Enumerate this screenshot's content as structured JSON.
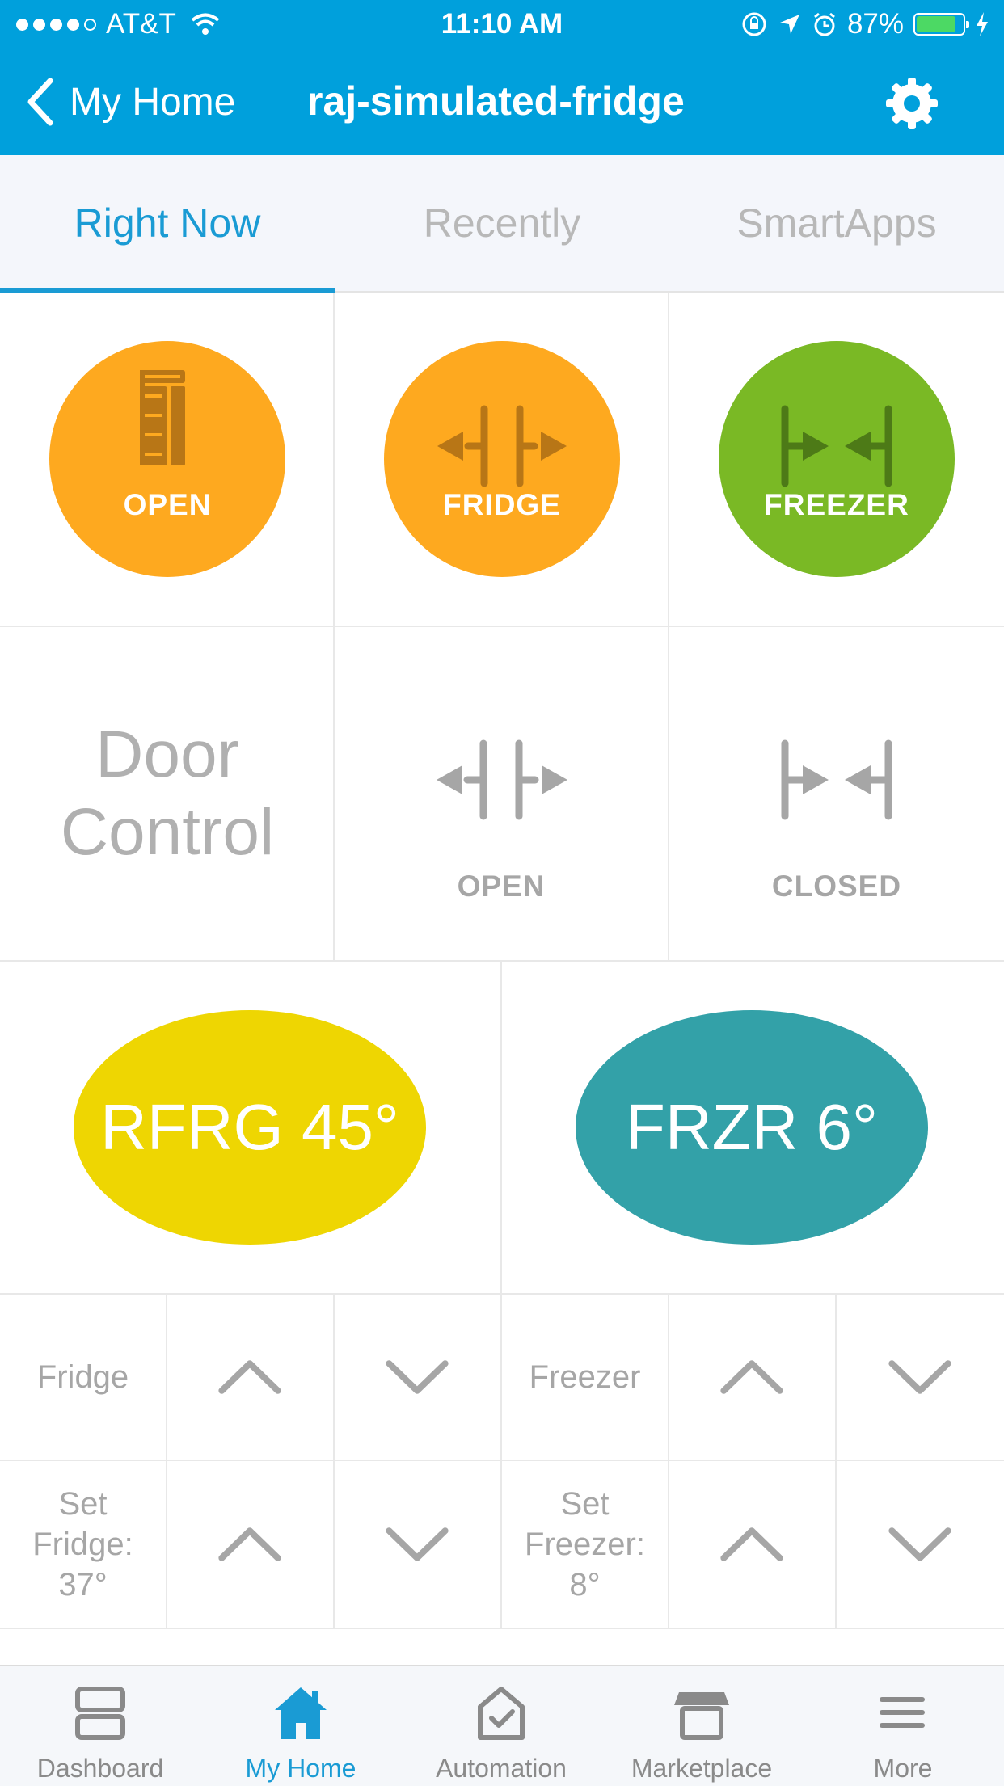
{
  "status_bar": {
    "carrier": "AT&T",
    "time": "11:10 AM",
    "battery": "87%",
    "battery_level": 0.87
  },
  "nav": {
    "back_label": "My Home",
    "title": "raj-simulated-fridge"
  },
  "tabs": [
    {
      "label": "Right Now",
      "active": true
    },
    {
      "label": "Recently",
      "active": false
    },
    {
      "label": "SmartApps",
      "active": false
    }
  ],
  "tiles": {
    "door_state": "OPEN",
    "fridge_state": "FRIDGE",
    "freezer_state": "FREEZER",
    "door_control_line1": "Door",
    "door_control_line2": "Control",
    "open_label": "OPEN",
    "closed_label": "CLOSED",
    "fridge_temp": "RFRG 45°",
    "freezer_temp": "FRZR 6°",
    "fridge_label": "Fridge",
    "freezer_label": "Freezer",
    "set_fridge": [
      "Set",
      "Fridge:",
      "37°"
    ],
    "set_freezer": [
      "Set",
      "Freezer:",
      "8°"
    ]
  },
  "colors": {
    "header": "#00a0dc",
    "orange": "#fea91f",
    "green": "#7ab925",
    "yellow": "#eed602",
    "teal": "#33a1a8",
    "active_tab": "#1a9bd4"
  },
  "bottom_nav": [
    {
      "label": "Dashboard",
      "icon": "dashboard-icon",
      "active": false
    },
    {
      "label": "My Home",
      "icon": "home-icon",
      "active": true
    },
    {
      "label": "Automation",
      "icon": "automation-icon",
      "active": false
    },
    {
      "label": "Marketplace",
      "icon": "marketplace-icon",
      "active": false
    },
    {
      "label": "More",
      "icon": "menu-icon",
      "active": false
    }
  ]
}
